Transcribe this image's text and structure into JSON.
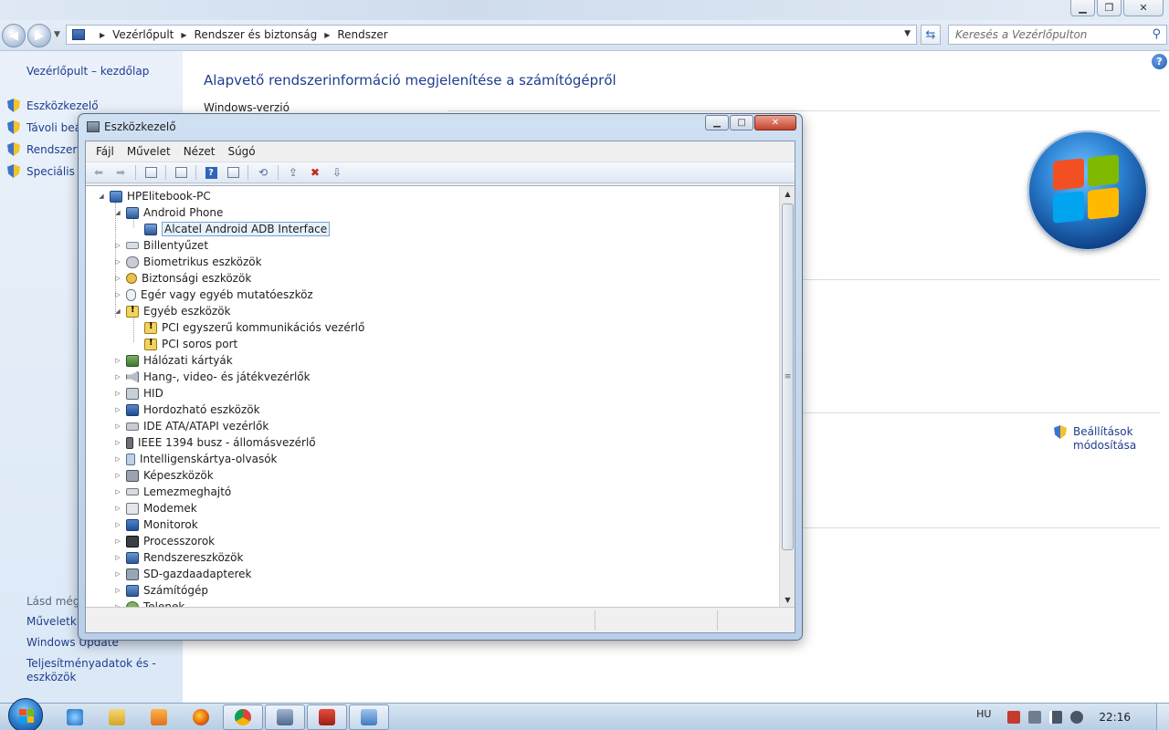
{
  "control_panel": {
    "breadcrumb": [
      "Vezérlőpult",
      "Rendszer és biztonság",
      "Rendszer"
    ],
    "search_placeholder": "Keresés a Vezérlőpulton",
    "left": {
      "home": "Vezérlőpult – kezdőlap",
      "tasks": [
        "Eszközkezelő",
        "Távoli beá",
        "Rendszerve",
        "Speciális re"
      ],
      "see_also_heading": "Lásd még:",
      "see_also": [
        "Műveletk",
        "Windows Update",
        "Teljesítményadatok és -eszközök"
      ]
    },
    "heading": "Alapvető rendszerinformáció megjelenítése a számítógépről",
    "section_windows_version": "Windows-verzió",
    "settings_link": "Beállítások módosítása"
  },
  "device_manager": {
    "title": "Eszközkezelő",
    "menu": [
      "Fájl",
      "Művelet",
      "Nézet",
      "Súgó"
    ],
    "tree": [
      {
        "label": "HPElitebook-PC",
        "level": 0,
        "expander": "◢",
        "icon": "computer-icon",
        "cls": "ico-pc"
      },
      {
        "label": "Android Phone",
        "level": 1,
        "expander": "◢",
        "icon": "phone-icon",
        "cls": "ico-phone"
      },
      {
        "label": "Alcatel Android ADB Interface",
        "level": 2,
        "expander": "",
        "icon": "phone-device-icon",
        "cls": "ico-phone",
        "selected": true
      },
      {
        "label": "Billentyűzet",
        "level": 1,
        "expander": "▷",
        "icon": "keyboard-icon",
        "cls": "ico-kbd"
      },
      {
        "label": "Biometrikus eszközök",
        "level": 1,
        "expander": "▷",
        "icon": "biometric-icon",
        "cls": "ico-bio"
      },
      {
        "label": "Biztonsági eszközök",
        "level": 1,
        "expander": "▷",
        "icon": "security-key-icon",
        "cls": "ico-key"
      },
      {
        "label": "Egér vagy egyéb mutatóeszköz",
        "level": 1,
        "expander": "▷",
        "icon": "mouse-icon",
        "cls": "ico-mouse"
      },
      {
        "label": "Egyéb eszközök",
        "level": 1,
        "expander": "◢",
        "icon": "unknown-device-icon",
        "cls": "ico-warn"
      },
      {
        "label": "PCI egyszerű kommunikációs vezérlő",
        "level": 2,
        "expander": "",
        "icon": "warning-device-icon",
        "cls": "ico-warn"
      },
      {
        "label": "PCI soros port",
        "level": 2,
        "expander": "",
        "icon": "warning-device-icon",
        "cls": "ico-warn"
      },
      {
        "label": "Hálózati kártyák",
        "level": 1,
        "expander": "▷",
        "icon": "network-adapter-icon",
        "cls": "ico-net"
      },
      {
        "label": "Hang-, video- és játékvezérlők",
        "level": 1,
        "expander": "▷",
        "icon": "sound-icon",
        "cls": "ico-snd"
      },
      {
        "label": "HID",
        "level": 1,
        "expander": "▷",
        "icon": "hid-icon",
        "cls": "ico-hid"
      },
      {
        "label": "Hordozható eszközök",
        "level": 1,
        "expander": "▷",
        "icon": "portable-device-icon",
        "cls": "ico-port"
      },
      {
        "label": "IDE ATA/ATAPI vezérlők",
        "level": 1,
        "expander": "▷",
        "icon": "ide-controller-icon",
        "cls": "ico-ide"
      },
      {
        "label": "IEEE 1394 busz - állomásvezérlő",
        "level": 1,
        "expander": "▷",
        "icon": "firewire-icon",
        "cls": "ico-1394"
      },
      {
        "label": "Intelligenskártya-olvasók",
        "level": 1,
        "expander": "▷",
        "icon": "smartcard-reader-icon",
        "cls": "ico-card"
      },
      {
        "label": "Képeszközök",
        "level": 1,
        "expander": "▷",
        "icon": "camera-icon",
        "cls": "ico-cam"
      },
      {
        "label": "Lemezmeghajtó",
        "level": 1,
        "expander": "▷",
        "icon": "disk-drive-icon",
        "cls": "ico-fd"
      },
      {
        "label": "Modemek",
        "level": 1,
        "expander": "▷",
        "icon": "modem-icon",
        "cls": "ico-modem"
      },
      {
        "label": "Monitorok",
        "level": 1,
        "expander": "▷",
        "icon": "monitor-icon",
        "cls": "ico-mon"
      },
      {
        "label": "Processzorok",
        "level": 1,
        "expander": "▷",
        "icon": "processor-icon",
        "cls": "ico-cpu"
      },
      {
        "label": "Rendszereszközök",
        "level": 1,
        "expander": "▷",
        "icon": "system-devices-icon",
        "cls": "ico-sys"
      },
      {
        "label": "SD-gazdaadapterek",
        "level": 1,
        "expander": "▷",
        "icon": "sd-host-icon",
        "cls": "ico-sd"
      },
      {
        "label": "Számítógép",
        "level": 1,
        "expander": "▷",
        "icon": "computer-icon",
        "cls": "ico-sys"
      },
      {
        "label": "Telenek",
        "level": 1,
        "expander": "▷",
        "icon": "battery-icon",
        "cls": "ico-tel"
      }
    ]
  },
  "taskbar": {
    "language": "HU",
    "clock": "22:16",
    "apps": [
      "ie-icon",
      "explorer-icon",
      "media-player-icon",
      "firefox-icon",
      "chrome-icon",
      "device-manager-icon",
      "app-icon",
      "control-panel-icon"
    ]
  }
}
